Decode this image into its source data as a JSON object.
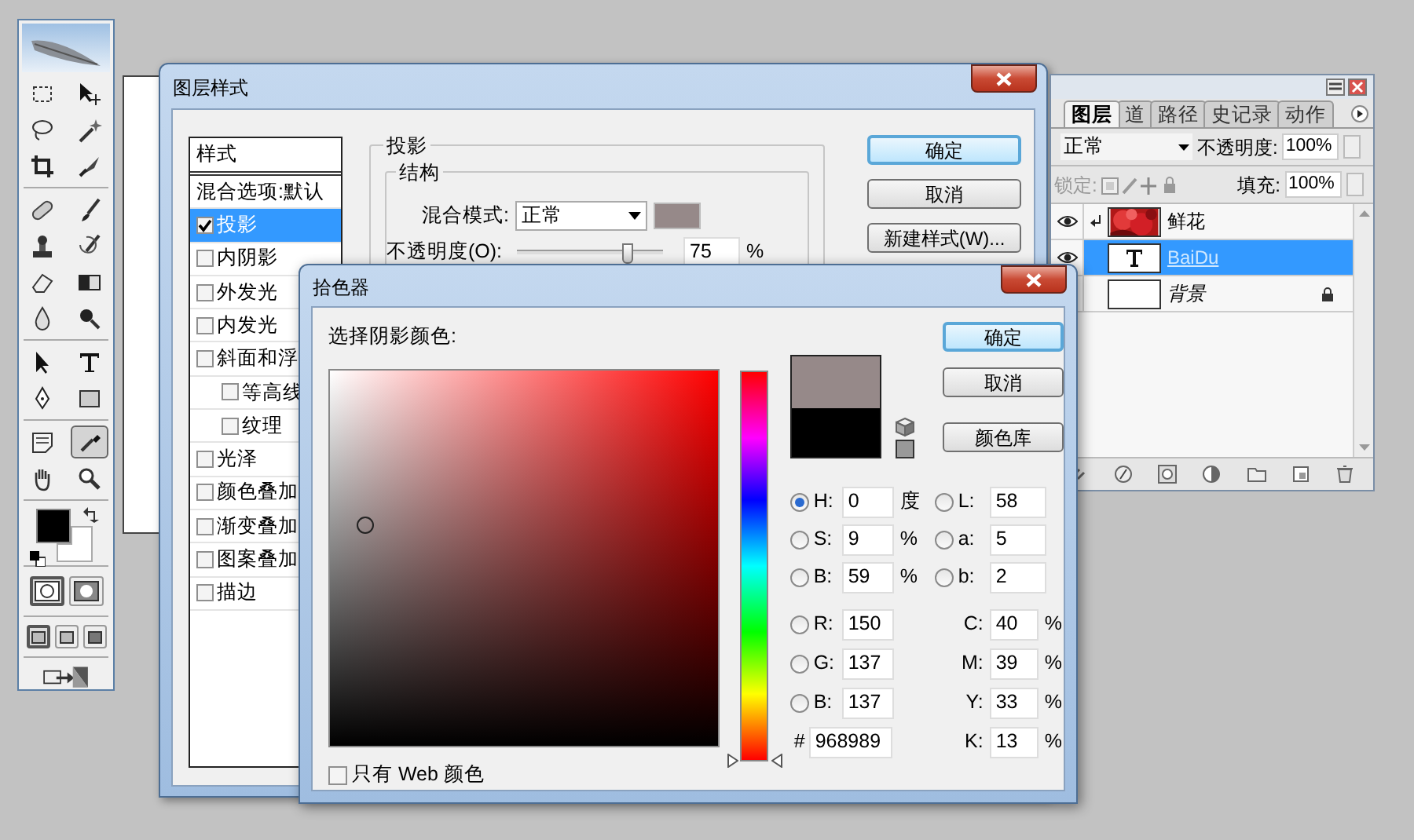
{
  "toolbox": {
    "tools": [
      {
        "selected": false
      },
      {
        "selected": false
      },
      {
        "selected": false
      },
      {
        "selected": false
      },
      {
        "selected": false
      },
      {
        "selected": false
      },
      {
        "selected": false
      },
      {
        "selected": false
      },
      {
        "selected": false
      },
      {
        "selected": false
      },
      {
        "selected": false
      },
      {
        "selected": false
      },
      {
        "selected": false
      },
      {
        "selected": false
      },
      {
        "selected": false
      },
      {
        "selected": false
      },
      {
        "selected": false
      },
      {
        "selected": false
      },
      {
        "selected": false
      },
      {
        "selected": true
      },
      {
        "selected": false
      },
      {
        "selected": false
      }
    ],
    "mask_modes": [
      {
        "selected": true
      },
      {
        "selected": false
      }
    ],
    "screen_modes": [
      {
        "selected": true
      },
      {
        "selected": false
      },
      {
        "selected": false
      }
    ]
  },
  "layer_style": {
    "title": "图层样式",
    "styles_header": "样式",
    "styles": [
      {
        "kind": "option",
        "label": "混合选项:默认",
        "selected": false
      },
      {
        "kind": "effect",
        "label": "投影",
        "checked": true,
        "selected": true
      },
      {
        "kind": "effect",
        "label": "内阴影",
        "checked": false,
        "selected": false
      },
      {
        "kind": "effect",
        "label": "外发光",
        "checked": false,
        "selected": false
      },
      {
        "kind": "effect",
        "label": "内发光",
        "checked": false,
        "selected": false
      },
      {
        "kind": "effect",
        "label": "斜面和浮",
        "checked": false,
        "selected": false,
        "children": [
          {
            "kind": "effect",
            "label": "等高线",
            "checked": false,
            "selected": false
          },
          {
            "kind": "effect",
            "label": "纹理",
            "checked": false,
            "selected": false
          }
        ]
      },
      {
        "kind": "effect",
        "label": "光泽",
        "checked": false,
        "selected": false
      },
      {
        "kind": "effect",
        "label": "颜色叠加",
        "checked": false,
        "selected": false
      },
      {
        "kind": "effect",
        "label": "渐变叠加",
        "checked": false,
        "selected": false
      },
      {
        "kind": "effect",
        "label": "图案叠加",
        "checked": false,
        "selected": false
      },
      {
        "kind": "effect",
        "label": "描边",
        "checked": false,
        "selected": false
      }
    ],
    "section": "投影",
    "group": "结构",
    "blend_mode": {
      "label": "混合模式:",
      "value": "正常"
    },
    "opacity": {
      "label": "不透明度(O):",
      "level": 0.75,
      "value": "75",
      "unit": "%"
    },
    "buttons": [
      {
        "label": "确定",
        "default": true
      },
      {
        "label": "取消",
        "default": false
      },
      {
        "label": "新建样式(W)...",
        "default": false
      }
    ]
  },
  "color_picker": {
    "title": "拾色器",
    "prompt": "选择阴影颜色:",
    "buttons": [
      {
        "label": "确定",
        "default": true
      },
      {
        "label": "取消",
        "default": false
      },
      {
        "label": "颜色库",
        "default": false
      }
    ],
    "hsb": [
      {
        "label": "H:",
        "value": "0",
        "unit": "度",
        "selected": true
      },
      {
        "label": "S:",
        "value": "9",
        "unit": "%",
        "selected": false
      },
      {
        "label": "B:",
        "value": "59",
        "unit": "%",
        "selected": false
      }
    ],
    "lab": [
      {
        "label": "L:",
        "value": "58",
        "selected": false
      },
      {
        "label": "a:",
        "value": "5",
        "selected": false
      },
      {
        "label": "b:",
        "value": "2",
        "selected": false
      }
    ],
    "rgb": [
      {
        "label": "R:",
        "value": "150",
        "selected": false
      },
      {
        "label": "G:",
        "value": "137",
        "selected": false
      },
      {
        "label": "B:",
        "value": "137",
        "selected": false
      }
    ],
    "hex": {
      "label": "#",
      "value": "968989"
    },
    "cmyk": [
      {
        "label": "C:",
        "value": "40",
        "unit": "%"
      },
      {
        "label": "M:",
        "value": "39",
        "unit": "%"
      },
      {
        "label": "Y:",
        "value": "33",
        "unit": "%"
      },
      {
        "label": "K:",
        "value": "13",
        "unit": "%"
      }
    ],
    "web_only": {
      "label": "只有 Web 颜色",
      "checked": false
    }
  },
  "layers_panel": {
    "tabs": [
      {
        "label": "图层",
        "selected": true
      },
      {
        "label": "道",
        "selected": false
      },
      {
        "label": "路径",
        "selected": false
      },
      {
        "label": "史记录",
        "selected": false
      },
      {
        "label": "动作",
        "selected": false
      }
    ],
    "blend_mode": "正常",
    "opacity": {
      "label": "不透明度:",
      "value": "100%"
    },
    "lock_label": "锁定:",
    "fill": {
      "label": "填充:",
      "value": "100%"
    },
    "layers": [
      {
        "name": "鲜花",
        "visible": true,
        "clipped": true,
        "selected": false
      },
      {
        "kind": "text",
        "name": "BaiDu",
        "visible": true,
        "selected": true
      },
      {
        "kind": "background",
        "name": "背景",
        "locked": true,
        "selected": false
      }
    ]
  }
}
